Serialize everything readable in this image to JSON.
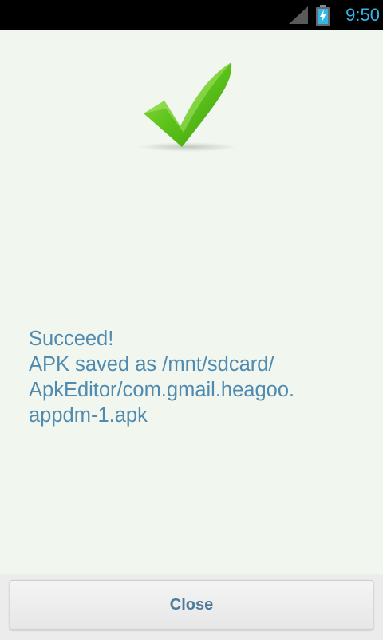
{
  "status_bar": {
    "time": "9:50",
    "icons": [
      "signal-icon",
      "battery-charging-icon"
    ],
    "accent_color": "#33b5e5"
  },
  "result": {
    "icon": "checkmark-icon",
    "icon_color": "#5cc21a",
    "message_lines": [
      "Succeed!",
      "APK saved as /mnt/sdcard/",
      "ApkEditor/com.gmail.heagoo.",
      "appdm-1.apk"
    ],
    "text_color": "#4f8ab0"
  },
  "footer": {
    "close_label": "Close"
  }
}
